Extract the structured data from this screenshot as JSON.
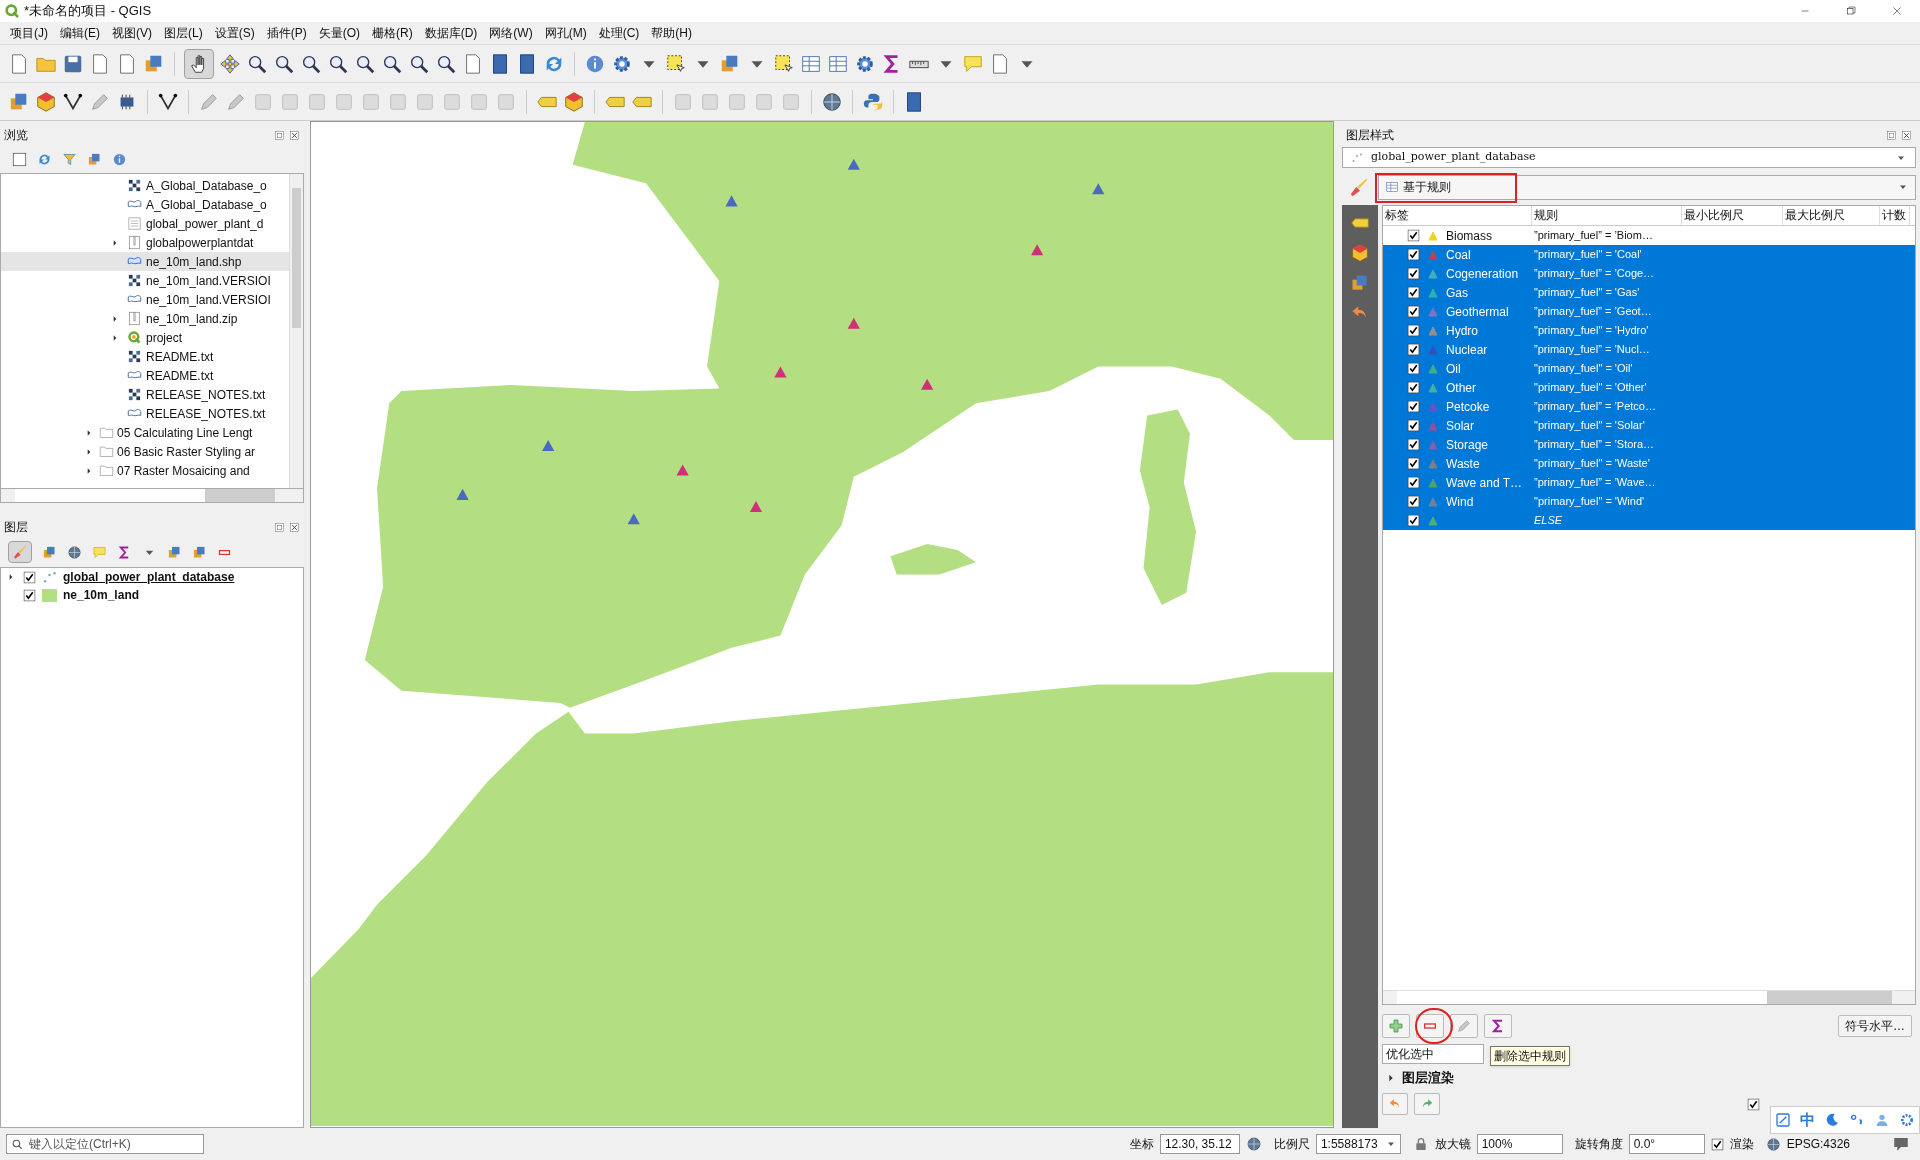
{
  "window": {
    "title": "*未命名的项目 - QGIS"
  },
  "menu": [
    "项目(J)",
    "编辑(E)",
    "视图(V)",
    "图层(L)",
    "设置(S)",
    "插件(P)",
    "矢量(O)",
    "栅格(R)",
    "数据库(D)",
    "网络(W)",
    "网孔(M)",
    "处理(C)",
    "帮助(H)"
  ],
  "toolbars": {
    "pan_tool_selected": true
  },
  "browser_panel": {
    "title": "浏览",
    "files": [
      {
        "label": "A_Global_Database_o",
        "kind": "raster",
        "expandable": false,
        "selected": false
      },
      {
        "label": "A_Global_Database_o",
        "kind": "vector",
        "expandable": false,
        "selected": false
      },
      {
        "label": "global_power_plant_d",
        "kind": "table",
        "expandable": false,
        "selected": false
      },
      {
        "label": "globalpowerplantdat",
        "kind": "zip",
        "expandable": true,
        "selected": false
      },
      {
        "label": "ne_10m_land.shp",
        "kind": "vector",
        "expandable": false,
        "selected": true
      },
      {
        "label": "ne_10m_land.VERSIOI",
        "kind": "raster",
        "expandable": false,
        "selected": false
      },
      {
        "label": "ne_10m_land.VERSIOI",
        "kind": "vector",
        "expandable": false,
        "selected": false
      },
      {
        "label": "ne_10m_land.zip",
        "kind": "zip",
        "expandable": true,
        "selected": false
      },
      {
        "label": "project",
        "kind": "project",
        "expandable": true,
        "selected": false
      },
      {
        "label": "README.txt",
        "kind": "raster",
        "expandable": false,
        "selected": false
      },
      {
        "label": "README.txt",
        "kind": "vector",
        "expandable": false,
        "selected": false
      },
      {
        "label": "RELEASE_NOTES.txt",
        "kind": "raster",
        "expandable": false,
        "selected": false
      },
      {
        "label": "RELEASE_NOTES.txt",
        "kind": "vector",
        "expandable": false,
        "selected": false
      }
    ],
    "folders": [
      {
        "label": "05 Calculating Line Lengt"
      },
      {
        "label": "06 Basic Raster Styling ar"
      },
      {
        "label": "07 Raster Mosaicing and"
      }
    ]
  },
  "layers_panel": {
    "title": "图层",
    "styling_toggle_selected": true,
    "layers": [
      {
        "name": "global_power_plant_database",
        "kind": "points",
        "checked": true,
        "selected": true,
        "expandable": true
      },
      {
        "name": "ne_10m_land",
        "kind": "polygon",
        "checked": true,
        "selected": false,
        "expandable": false
      }
    ]
  },
  "layer_styling": {
    "title": "图层样式",
    "layer": "global_power_plant_database",
    "renderer": "基于规则",
    "columns": [
      "标签",
      "规则",
      "最小比例尺",
      "最大比例尺",
      "计数"
    ],
    "rules": [
      {
        "kind": "rule",
        "label": "Biomass",
        "rule": "”primary_fuel” = ’Biom…",
        "checked": true,
        "selected": false,
        "color": "#e8d820"
      },
      {
        "kind": "rule",
        "label": "Coal",
        "rule": "\"primary_fuel\" = 'Coal'",
        "checked": true,
        "selected": true,
        "color": "#c04058"
      },
      {
        "kind": "rule",
        "label": "Cogeneration",
        "rule": "”primary_fuel” = ’Coge…",
        "checked": true,
        "selected": true,
        "color": "#40b0b8"
      },
      {
        "kind": "rule",
        "label": "Gas",
        "rule": "\"primary_fuel\" = 'Gas'",
        "checked": true,
        "selected": true,
        "color": "#30b0a8"
      },
      {
        "kind": "rule",
        "label": "Geothermal",
        "rule": "”primary_fuel” = ’Geot…",
        "checked": true,
        "selected": true,
        "color": "#8070c8"
      },
      {
        "kind": "rule",
        "label": "Hydro",
        "rule": "\"primary_fuel\" = 'Hydro'",
        "checked": true,
        "selected": true,
        "color": "#909090"
      },
      {
        "kind": "rule",
        "label": "Nuclear",
        "rule": "”primary_fuel” = ’Nucl…",
        "checked": true,
        "selected": true,
        "color": "#3050c0"
      },
      {
        "kind": "rule",
        "label": "Oil",
        "rule": "\"primary_fuel\" = 'Oil'",
        "checked": true,
        "selected": true,
        "color": "#40b080"
      },
      {
        "kind": "rule",
        "label": "Other",
        "rule": "\"primary_fuel\" = 'Other'",
        "checked": true,
        "selected": true,
        "color": "#40b0a0"
      },
      {
        "kind": "rule",
        "label": "Petcoke",
        "rule": "”primary_fuel” = ’Petco…",
        "checked": true,
        "selected": true,
        "color": "#7050c0"
      },
      {
        "kind": "rule",
        "label": "Solar",
        "rule": "\"primary_fuel\" = 'Solar'",
        "checked": true,
        "selected": true,
        "color": "#9050a0"
      },
      {
        "kind": "rule",
        "label": "Storage",
        "rule": "”primary_fuel” = ’Stora…",
        "checked": true,
        "selected": true,
        "color": "#8060b0"
      },
      {
        "kind": "rule",
        "label": "Waste",
        "rule": "\"primary_fuel\" = 'Waste'",
        "checked": true,
        "selected": true,
        "color": "#808080"
      },
      {
        "kind": "rule",
        "label": "Wave and T…",
        "rule": "”primary_fuel” = ’Wave…",
        "checked": true,
        "selected": true,
        "color": "#50a070"
      },
      {
        "kind": "rule",
        "label": "Wind",
        "rule": "\"primary_fuel\" = 'Wind'",
        "checked": true,
        "selected": true,
        "color": "#7080a0"
      },
      {
        "kind": "else",
        "rule": "ELSE",
        "checked": true,
        "selected": true,
        "color": "#50b070"
      }
    ],
    "tooltip": "删除选中规则",
    "refine": "优化选中",
    "symbol_levels": "符号水平…",
    "rendering_section": "图层渲染",
    "live_update_checked": true
  },
  "status_bar": {
    "search_placeholder": "键入以定位(Ctrl+K)",
    "coordinate_label": "坐标",
    "coordinate": "12.30, 35.12",
    "scale_label": "比例尺",
    "scale": "1:5588173",
    "magnifier_label": "放大镜",
    "magnifier": "100%",
    "rotation_label": "旋转角度",
    "rotation": "0.0°",
    "render_checked": true,
    "render_label": "渲染",
    "crs": "EPSG:4326"
  },
  "ime_bar": {
    "mode": "中"
  }
}
